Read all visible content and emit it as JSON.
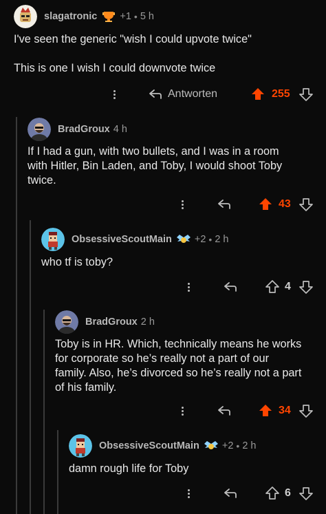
{
  "colors": {
    "background": "#0b0b0b",
    "upvote_active": "#ff4500",
    "thread_line": "#3a3a3a",
    "text": "#e8e8e8"
  },
  "comments": [
    {
      "author": "slagatronic",
      "flair_icon": "trophy-badge-icon",
      "awards": "+1",
      "time": "5 h",
      "lines": [
        "I've seen the generic \"wish I could upvote twice\"",
        "",
        "This is one I wish I could downvote twice"
      ],
      "reply_label": "Antworten",
      "score": "255",
      "upvoted": true
    },
    {
      "author": "BradGroux",
      "time": "4 h",
      "lines": [
        "If I had a gun, with two bullets, and I was in a room",
        "with Hitler, Bin Laden, and Toby, I would shoot Toby",
        "twice."
      ],
      "score": "43",
      "upvoted": true
    },
    {
      "author": "ObsessiveScoutMain",
      "flair_icon": "wings-badge-icon",
      "awards": "+2",
      "time": "2 h",
      "lines": [
        "who tf is toby?"
      ],
      "score": "4",
      "upvoted": false
    },
    {
      "author": "BradGroux",
      "time": "2 h",
      "lines": [
        "Toby is in HR. Which, technically means he works",
        "for corporate so he’s really not a part of our",
        "family. Also, he’s divorced so he’s really not a part",
        "of his family."
      ],
      "score": "34",
      "upvoted": true
    },
    {
      "author": "ObsessiveScoutMain",
      "flair_icon": "wings-badge-icon",
      "awards": "+2",
      "time": "2 h",
      "lines": [
        "damn rough life for Toby"
      ],
      "score": "6",
      "upvoted": false
    }
  ]
}
